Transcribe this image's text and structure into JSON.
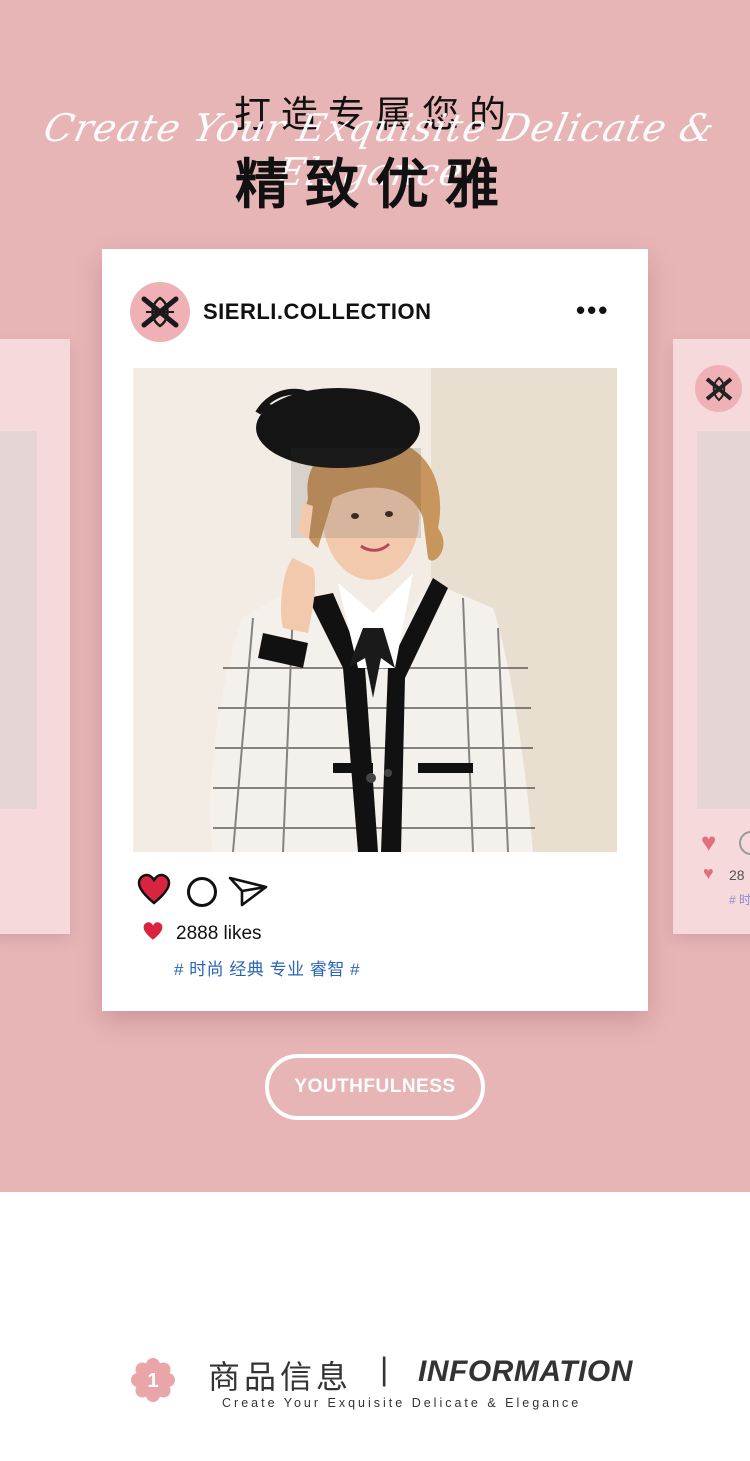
{
  "hero": {
    "title_line1": "打造专属您的",
    "script_text": "Create Your Exquisite Delicate & Elegance",
    "title_line2": "精致优雅",
    "background": "#e8b5b7"
  },
  "post": {
    "handle": "SIERLI.COLLECTION",
    "more_label": "•••",
    "likes_text": "2888 likes",
    "tags": "# 时尚 经典 专业 睿智 #",
    "icons": [
      "heart-icon",
      "comment-icon",
      "send-icon",
      "more-icon"
    ]
  },
  "side_right": {
    "likes_text": "28",
    "tags": "# 时"
  },
  "pill_label": "YOUTHFULNESS",
  "info": {
    "badge_number": "1",
    "title_cn": "商品信息",
    "separator": "|",
    "title_en": "INFORMATION",
    "subtitle": "Create Your Exquisite Delicate & Elegance"
  },
  "colors": {
    "accent_pink": "#efb1b5",
    "heart_red": "#d8243f",
    "tag_blue": "#2a64b4"
  }
}
